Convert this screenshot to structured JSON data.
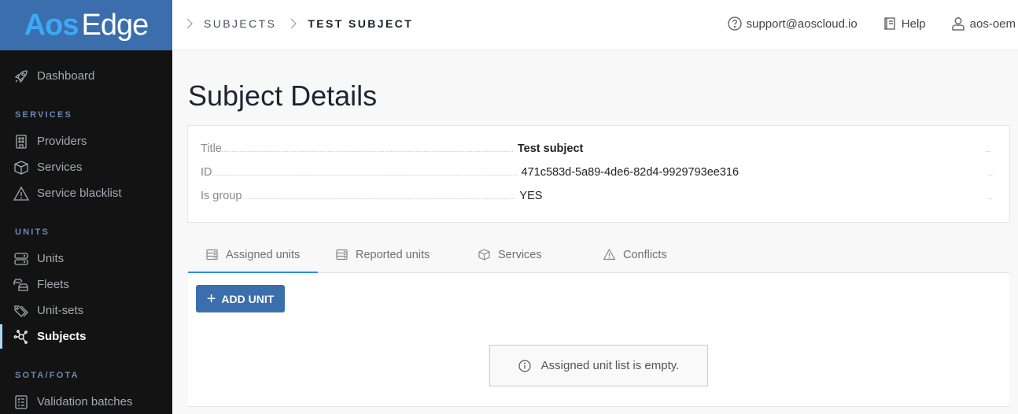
{
  "app": {
    "logo_part1": "Aos",
    "logo_part2": "Edge"
  },
  "sidebar": {
    "dashboard": {
      "label": "Dashboard",
      "icon": "rocket-icon"
    },
    "sections": [
      {
        "title": "SERVICES",
        "items": [
          {
            "label": "Providers",
            "icon": "building-icon"
          },
          {
            "label": "Services",
            "icon": "cube-icon"
          },
          {
            "label": "Service blacklist",
            "icon": "warning-icon"
          }
        ]
      },
      {
        "title": "UNITS",
        "items": [
          {
            "label": "Units",
            "icon": "server-icon"
          },
          {
            "label": "Fleets",
            "icon": "cars-icon"
          },
          {
            "label": "Unit-sets",
            "icon": "tags-icon"
          },
          {
            "label": "Subjects",
            "icon": "network-icon",
            "active": true
          }
        ]
      },
      {
        "title": "SOTA/FOTA",
        "items": [
          {
            "label": "Validation batches",
            "icon": "checklist-icon"
          }
        ]
      }
    ]
  },
  "header": {
    "breadcrumb": [
      {
        "label": "SUBJECTS"
      },
      {
        "label": "TEST SUBJECT"
      }
    ],
    "support_email": "support@aoscloud.io",
    "help_label": "Help",
    "user_name": "aos-oem"
  },
  "main": {
    "title": "Subject Details",
    "details": [
      {
        "label": "Title",
        "value": "Test subject"
      },
      {
        "label": "ID",
        "value": "471c583d-5a89-4de6-82d4-9929793ee316"
      },
      {
        "label": "Is group",
        "value": "YES"
      }
    ],
    "tabs": [
      {
        "label": "Assigned units",
        "icon": "server-icon",
        "active": true
      },
      {
        "label": "Reported units",
        "icon": "server-icon"
      },
      {
        "label": "Services",
        "icon": "cube-icon"
      },
      {
        "label": "Conflicts",
        "icon": "warning-icon"
      }
    ],
    "add_button_label": "ADD UNIT",
    "empty_message": "Assigned unit list is empty."
  },
  "colors": {
    "brand_blue": "#3a6ead",
    "logo_accent": "#3fa9f5",
    "tab_active": "#2f8fdc",
    "sidebar_bg": "#131313",
    "active_marker": "#a8d8f5"
  }
}
